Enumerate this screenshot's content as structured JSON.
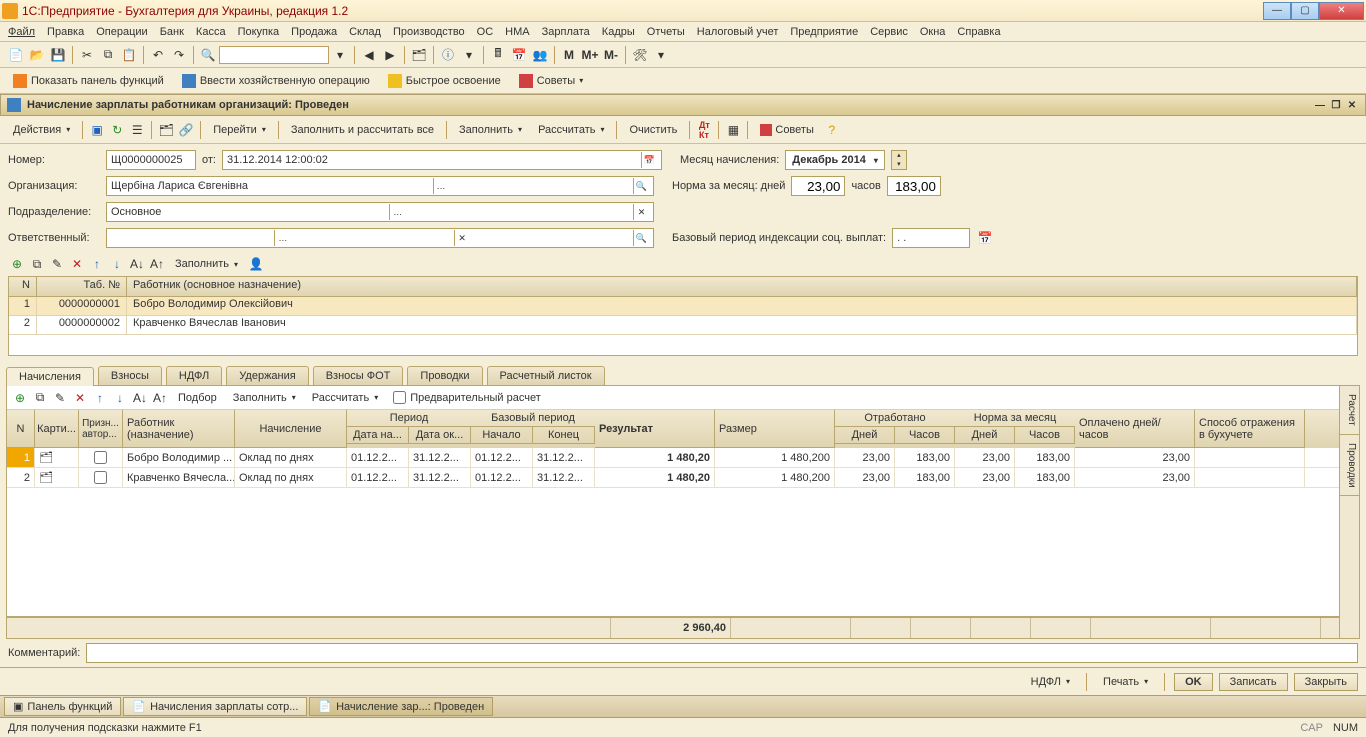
{
  "title": "1С:Предприятие - Бухгалтерия для Украины, редакция 1.2",
  "menu": [
    "Файл",
    "Правка",
    "Операции",
    "Банк",
    "Касса",
    "Покупка",
    "Продажа",
    "Склад",
    "Производство",
    "ОС",
    "НМА",
    "Зарплата",
    "Кадры",
    "Отчеты",
    "Налоговый учет",
    "Предприятие",
    "Сервис",
    "Окна",
    "Справка"
  ],
  "bigbuttons": {
    "panel": "Показать панель функций",
    "oper": "Ввести хозяйственную операцию",
    "quick": "Быстрое освоение",
    "advice": "Советы"
  },
  "doc_title": "Начисление зарплаты работникам организаций: Проведен",
  "doctb": {
    "actions": "Действия",
    "go": "Перейти",
    "fillcalc": "Заполнить и рассчитать все",
    "fill": "Заполнить",
    "calc": "Рассчитать",
    "clear": "Очистить",
    "dtkt": "Дт/Кт",
    "advice": "Советы"
  },
  "form": {
    "num_lbl": "Номер:",
    "num": "Щ0000000025",
    "ot": "от:",
    "date": "31.12.2014 12:00:02",
    "month_lbl": "Месяц начисления:",
    "month": "Декабрь 2014",
    "org_lbl": "Организация:",
    "org": "Щербіна Лариса Євгенівна",
    "norm_lbl": "Норма за месяц: дней",
    "norm_days": "23,00",
    "hours_lbl": "часов",
    "norm_hours": "183,00",
    "dept_lbl": "Подразделение:",
    "dept": "Основное",
    "resp_lbl": "Ответственный:",
    "resp": "",
    "base_lbl": "Базовый период индексации соц. выплат:",
    "base": ".  .",
    "fill_btn": "Заполнить"
  },
  "emp": {
    "hdr_n": "N",
    "hdr_tab": "Таб. №",
    "hdr_name": "Работник (основное назначение)",
    "rows": [
      {
        "n": "1",
        "tab": "0000000001",
        "name": "Бобро Володимир Олексійович"
      },
      {
        "n": "2",
        "tab": "0000000002",
        "name": "Кравченко Вячеслав Іванович"
      }
    ]
  },
  "tabs": [
    "Начисления",
    "Взносы",
    "НДФЛ",
    "Удержания",
    "Взносы ФОТ",
    "Проводки",
    "Расчетный листок"
  ],
  "grid_tb": {
    "select": "Подбор",
    "fill": "Заполнить",
    "calc": "Рассчитать",
    "prelim": "Предварительный расчет"
  },
  "ghdr": {
    "n": "N",
    "k": "Карти...",
    "p": "Призн... автор...",
    "emp": "Работник (назначение)",
    "nach": "Начисление",
    "period": "Период",
    "dn": "Дата на...",
    "dk": "Дата ок...",
    "bperiod": "Базовый период",
    "bn": "Начало",
    "bk": "Конец",
    "res": "Результат",
    "raz": "Размер",
    "worked": "Отработано",
    "wd": "Дней",
    "wh": "Часов",
    "norm": "Норма за месяц",
    "nd": "Дней",
    "nh": "Часов",
    "paid": "Оплачено дней/часов",
    "method": "Способ отражения в бухучете"
  },
  "grows": [
    {
      "n": "1",
      "emp": "Бобро Володимир ...",
      "nach": "Оклад по днях",
      "dn": "01.12.2...",
      "dk": "31.12.2...",
      "bn": "01.12.2...",
      "bk": "31.12.2...",
      "res": "1 480,20",
      "raz": "1 480,200",
      "wd": "23,00",
      "wh": "183,00",
      "nd": "23,00",
      "nh": "183,00",
      "paid": "23,00"
    },
    {
      "n": "2",
      "emp": "Кравченко Вячесла...",
      "nach": "Оклад по днях",
      "dn": "01.12.2...",
      "dk": "31.12.2...",
      "bn": "01.12.2...",
      "bk": "31.12.2...",
      "res": "1 480,20",
      "raz": "1 480,200",
      "wd": "23,00",
      "wh": "183,00",
      "nd": "23,00",
      "nh": "183,00",
      "paid": "23,00"
    }
  ],
  "gtotal": "2 960,40",
  "sidetabs": [
    "Расчет",
    "Проводки"
  ],
  "comment_lbl": "Комментарий:",
  "bottom": {
    "ndfl": "НДФЛ",
    "print": "Печать",
    "ok": "OK",
    "save": "Записать",
    "close": "Закрыть"
  },
  "task": {
    "panel": "Панель функций",
    "doc1": "Начисления зарплаты сотр...",
    "doc2": "Начисление зар...: Проведен"
  },
  "status": {
    "hint": "Для получения подсказки нажмите F1",
    "cap": "CAP",
    "num": "NUM"
  }
}
